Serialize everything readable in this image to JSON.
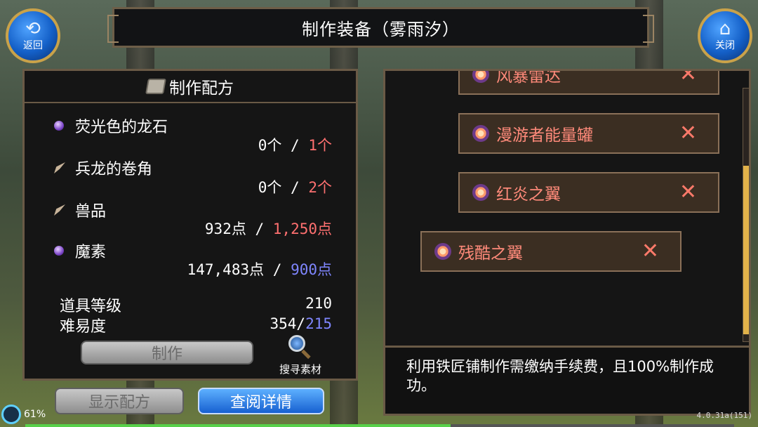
{
  "header": {
    "title": "制作装备（雾雨汐）",
    "back_label": "返回",
    "close_label": "关闭"
  },
  "recipe_panel": {
    "title": "制作配方",
    "materials": [
      {
        "name": "荧光色的龙石",
        "have": "0个",
        "sep": " / ",
        "need": "1个",
        "icon": "gem-icon"
      },
      {
        "name": "兵龙的卷角",
        "have": "0个",
        "sep": " / ",
        "need": "2个",
        "icon": "horn-icon"
      },
      {
        "name": "兽品",
        "have": "932点",
        "sep": " / ",
        "need": "1,250点",
        "icon": "horn-icon"
      },
      {
        "name": "魔素",
        "have": "147,483点",
        "sep": " / ",
        "need": "900点",
        "icon": "gem-icon"
      }
    ],
    "item_level_label": "道具等级",
    "item_level_value": "210",
    "difficulty_label": "难易度",
    "difficulty_current": "354/",
    "difficulty_required": "215",
    "make_label": "制作",
    "search_label": "搜寻素材"
  },
  "bottom_buttons": {
    "show_recipe": "显示配方",
    "view_details": "查阅详情"
  },
  "equipment_list": [
    {
      "name": "风暴雷达"
    },
    {
      "name": "漫游者能量罐"
    },
    {
      "name": "红炎之翼"
    },
    {
      "name": "残酷之翼"
    }
  ],
  "message": "利用铁匠铺制作需缴纳手续费，且100%制作成功。",
  "status": {
    "battery": "61%",
    "version": "4.0.31a(151)",
    "progress_fraction": 0.6
  },
  "colors": {
    "insufficient": "#ff7070",
    "sufficient": "#7f86ff",
    "accent_blue": "#1760d0"
  }
}
